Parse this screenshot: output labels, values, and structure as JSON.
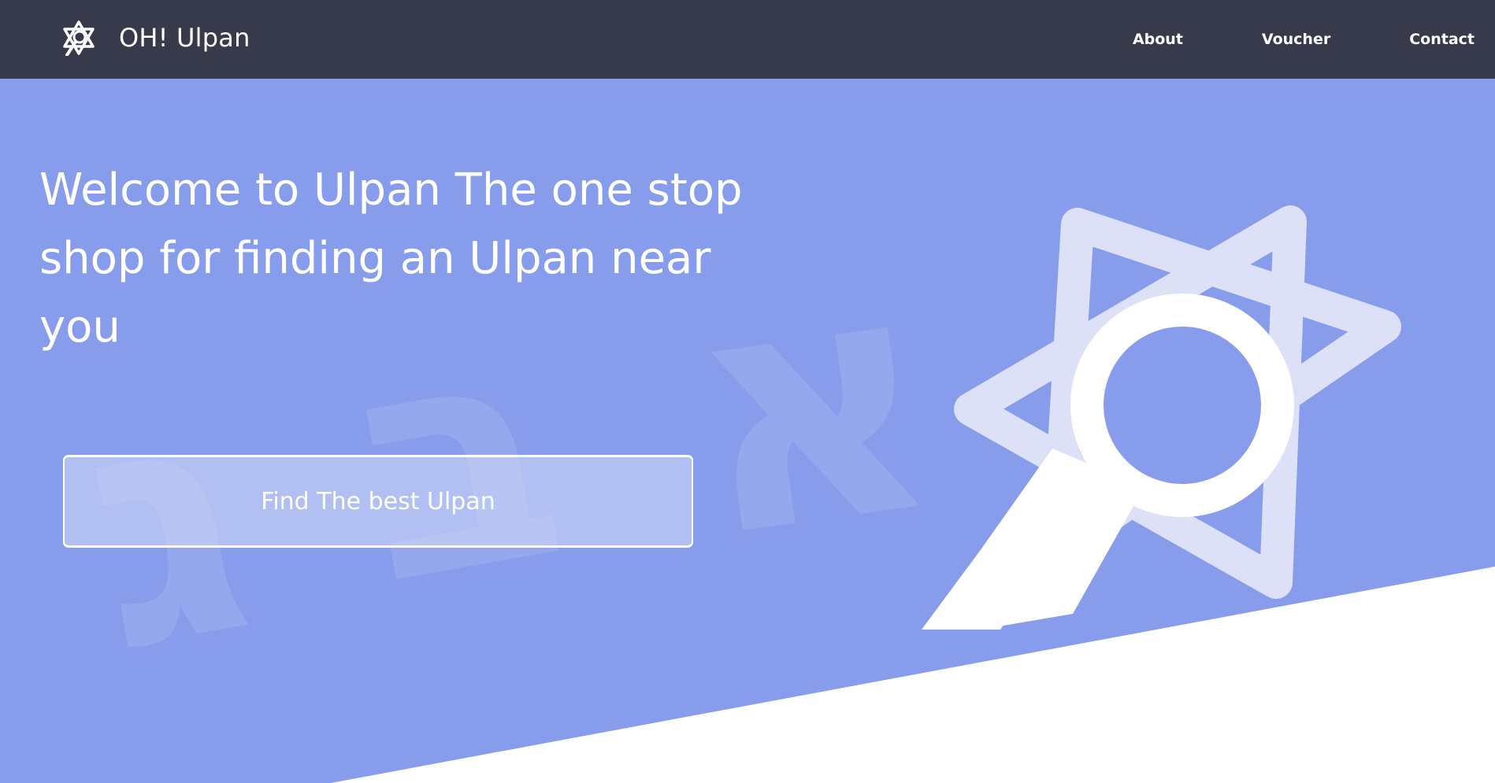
{
  "navbar": {
    "brand_name": "OH! Ulpan",
    "brand_icon": "star-of-david-icon",
    "links": [
      {
        "label": "About"
      },
      {
        "label": "Voucher"
      },
      {
        "label": "Contact"
      }
    ],
    "background_color": "#373a4b"
  },
  "hero": {
    "title": "Welcome to Ulpan The one stop shop for finding an Ulpan near you",
    "cta_label": "Find The best Ulpan",
    "background_color": "#879ceb",
    "decorative_letters": [
      "ג",
      "ב",
      "א"
    ],
    "illustration_icon": "star-of-david-magnifier-icon"
  }
}
